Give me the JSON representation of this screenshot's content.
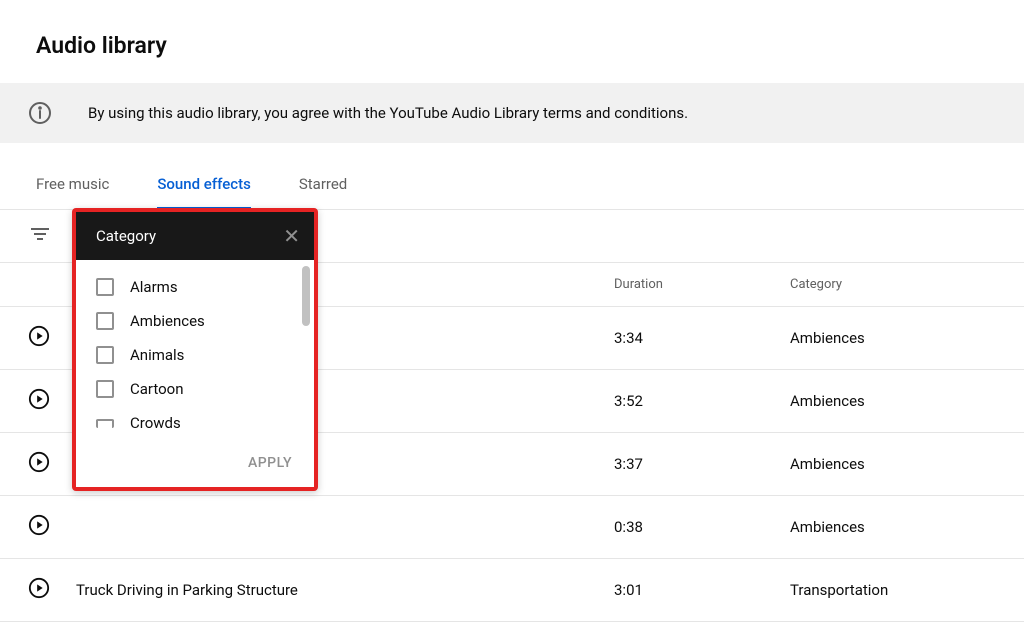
{
  "page": {
    "title": "Audio library"
  },
  "notice": {
    "text": "By using this audio library, you agree with the YouTube Audio Library terms and conditions."
  },
  "tabs": {
    "items": [
      {
        "label": "Free music",
        "active": false
      },
      {
        "label": "Sound effects",
        "active": true
      },
      {
        "label": "Starred",
        "active": false
      }
    ]
  },
  "table": {
    "headers": {
      "duration": "Duration",
      "category": "Category"
    },
    "rows": [
      {
        "title": "",
        "duration": "3:34",
        "category": "Ambiences"
      },
      {
        "title": "",
        "duration": "3:52",
        "category": "Ambiences"
      },
      {
        "title": "",
        "duration": "3:37",
        "category": "Ambiences"
      },
      {
        "title": "",
        "duration": "0:38",
        "category": "Ambiences"
      },
      {
        "title": "Truck Driving in Parking Structure",
        "duration": "3:01",
        "category": "Transportation"
      }
    ]
  },
  "filter_popup": {
    "title": "Category",
    "options": [
      "Alarms",
      "Ambiences",
      "Animals",
      "Cartoon",
      "Crowds"
    ],
    "apply_label": "APPLY"
  }
}
